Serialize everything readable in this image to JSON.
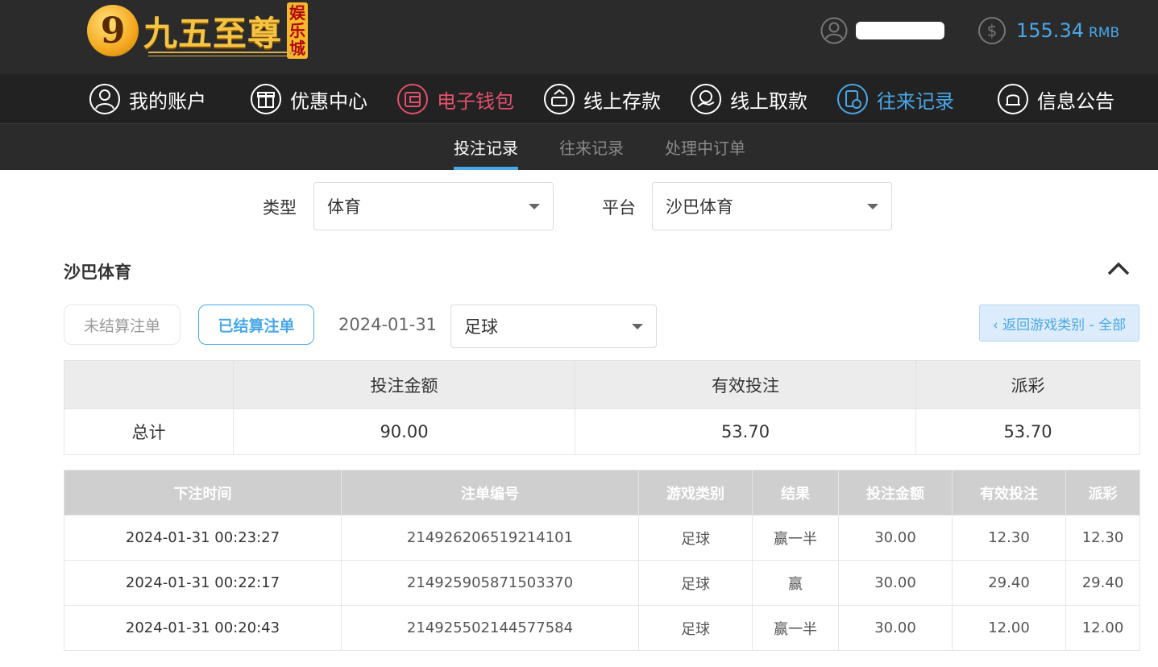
{
  "header": {
    "logo_mark": "9",
    "logo_text": "九五至尊",
    "logo_tag": [
      "娱",
      "乐",
      "城"
    ],
    "balance": "155.34",
    "currency": "RMB"
  },
  "nav": [
    {
      "label": "我的账户",
      "icon": "user-circle-icon"
    },
    {
      "label": "优惠中心",
      "icon": "gift-icon"
    },
    {
      "label": "电子钱包",
      "icon": "wallet-icon"
    },
    {
      "label": "线上存款",
      "icon": "deposit-icon"
    },
    {
      "label": "线上取款",
      "icon": "withdraw-icon"
    },
    {
      "label": "往来记录",
      "icon": "records-icon"
    },
    {
      "label": "信息公告",
      "icon": "bell-icon"
    }
  ],
  "subtabs": [
    "投注记录",
    "往来记录",
    "处理中订单"
  ],
  "filters": {
    "type_label": "类型",
    "type_value": "体育",
    "platform_label": "平台",
    "platform_value": "沙巴体育"
  },
  "section": {
    "title": "沙巴体育",
    "unsettled_label": "未结算注单",
    "settled_label": "已结算注单",
    "date": "2024-01-31",
    "sport_value": "足球",
    "back_label": "‹ 返回游戏类别 - 全部"
  },
  "summary": {
    "headers": [
      "",
      "投注金额",
      "有效投注",
      "派彩"
    ],
    "row_label": "总计",
    "bet_amount": "90.00",
    "valid_bet": "53.70",
    "payout": "53.70"
  },
  "detail": {
    "headers": [
      "下注时间",
      "注单编号",
      "游戏类别",
      "结果",
      "投注金额",
      "有效投注",
      "派彩"
    ],
    "rows": [
      [
        "2024-01-31 00:23:27",
        "214926206519214101",
        "足球",
        "赢一半",
        "30.00",
        "12.30",
        "12.30"
      ],
      [
        "2024-01-31 00:22:17",
        "214925905871503370",
        "足球",
        "赢",
        "30.00",
        "29.40",
        "29.40"
      ],
      [
        "2024-01-31 00:20:43",
        "214925502144577584",
        "足球",
        "赢一半",
        "30.00",
        "12.00",
        "12.00"
      ]
    ]
  },
  "colors": {
    "accent_blue": "#4aa7e8",
    "wallet_red": "#e3506b",
    "header_bg": "#2b2b2b",
    "nav_bg": "#222222"
  }
}
